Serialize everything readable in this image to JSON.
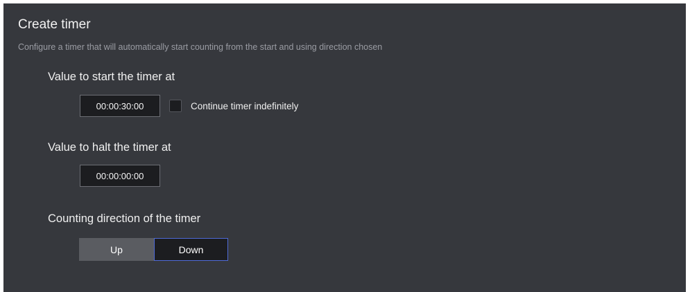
{
  "panel": {
    "title": "Create timer",
    "subtitle": "Configure a timer that will automatically start counting from the start and using direction chosen"
  },
  "start_section": {
    "label": "Value to start the timer at",
    "value": "00:00:30:00",
    "continue_checkbox": {
      "label": "Continue timer indefinitely",
      "checked": false
    }
  },
  "halt_section": {
    "label": "Value to halt the timer at",
    "value": "00:00:00:00"
  },
  "direction_section": {
    "label": "Counting direction of the timer",
    "options": [
      "Up",
      "Down"
    ],
    "selected": "Down"
  },
  "colors": {
    "panel_bg": "#36383d",
    "input_bg": "#1c1d20",
    "selected_border": "#4f6ad8",
    "unselected_bg": "#5a5c61"
  }
}
